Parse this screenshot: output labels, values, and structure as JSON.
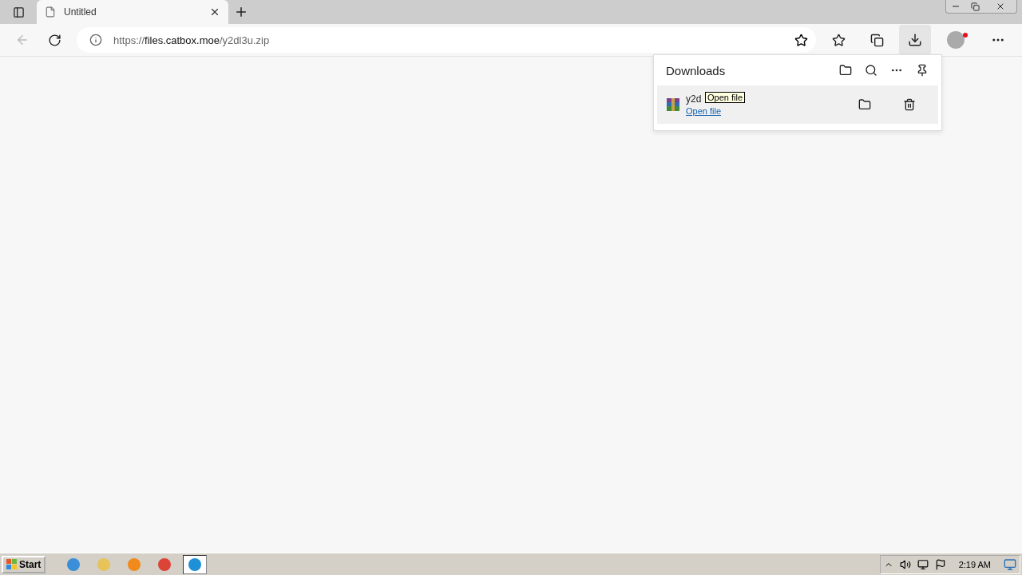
{
  "tabs": [
    {
      "title": "Untitled",
      "selected": true
    }
  ],
  "address": {
    "scheme": "https://",
    "host": "files.catbox.moe",
    "path": "/y2dl3u.zip"
  },
  "toolbar": {
    "downloads_selected": true,
    "profile_alert": true
  },
  "downloads": {
    "title": "Downloads",
    "items": [
      {
        "name": "y2d",
        "action": "Open file",
        "hovered": true
      }
    ],
    "tooltip": "Open file"
  },
  "taskbar": {
    "start": "Start",
    "apps": [
      {
        "kind": "ie",
        "selected": false
      },
      {
        "kind": "folder",
        "selected": false
      },
      {
        "kind": "media",
        "selected": false
      },
      {
        "kind": "chrome",
        "selected": false
      },
      {
        "kind": "edge",
        "selected": true
      }
    ],
    "clock": "2:19 AM"
  }
}
